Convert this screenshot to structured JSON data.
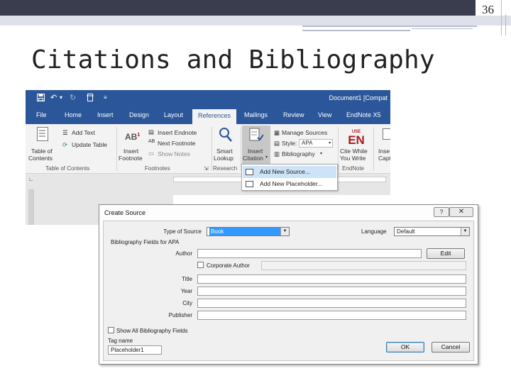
{
  "slide": {
    "page_number": "36",
    "title": "Citations and Bibliography"
  },
  "word": {
    "document_title": "Document1 [Compat",
    "tabs": [
      "File",
      "Home",
      "Insert",
      "Design",
      "Layout",
      "References",
      "Mailings",
      "Review",
      "View",
      "EndNote X5"
    ],
    "active_tab": "References",
    "ribbon": {
      "toc": {
        "label_line1": "Table of",
        "label_line2": "Contents",
        "add_text": "Add Text",
        "update_table": "Update Table",
        "group": "Table of Contents"
      },
      "footnotes": {
        "insert_label_line1": "Insert",
        "insert_label_line2": "Footnote",
        "insert_endnote": "Insert Endnote",
        "next_footnote": "Next Footnote",
        "show_notes": "Show Notes",
        "group": "Footnotes"
      },
      "research": {
        "label_line1": "Smart",
        "label_line2": "Lookup",
        "group": "Research"
      },
      "citations": {
        "insert_label_line1": "Insert",
        "insert_label_line2": "Citation",
        "manage_sources": "Manage Sources",
        "style_label": "Style:",
        "style_value": "APA",
        "bibliography": "Bibliography"
      },
      "endnote": {
        "logo_top": "USE",
        "logo": "EN",
        "cite_line1": "Cite While",
        "cite_line2": "You Write",
        "group": "EndNote"
      },
      "extra": {
        "label_line1": "Inse",
        "label_line2": "Capti"
      }
    },
    "citation_menu": {
      "items": [
        "Add New Source...",
        "Add New Placeholder..."
      ],
      "highlighted": "Add New Source..."
    }
  },
  "dialog": {
    "title": "Create Source",
    "help_glyph": "?",
    "close_glyph": "✕",
    "type_of_source_label": "Type of Source",
    "type_of_source_value": "Book",
    "language_label": "Language",
    "language_value": "Default",
    "fields_header": "Bibliography Fields for APA",
    "author_label": "Author",
    "edit_button": "Edit",
    "corporate_author_label": "Corporate Author",
    "title_label": "Title",
    "year_label": "Year",
    "city_label": "City",
    "publisher_label": "Publisher",
    "show_all_label": "Show All Bibliography Fields",
    "tag_name_label": "Tag name",
    "tag_name_value": "Placeholder1",
    "ok_button": "OK",
    "cancel_button": "Cancel"
  },
  "colors": {
    "word_blue": "#2b579a",
    "slide_dark_bar": "#3a3d4d",
    "menu_highlight": "#cde3f7",
    "selection_blue": "#3399ff"
  }
}
